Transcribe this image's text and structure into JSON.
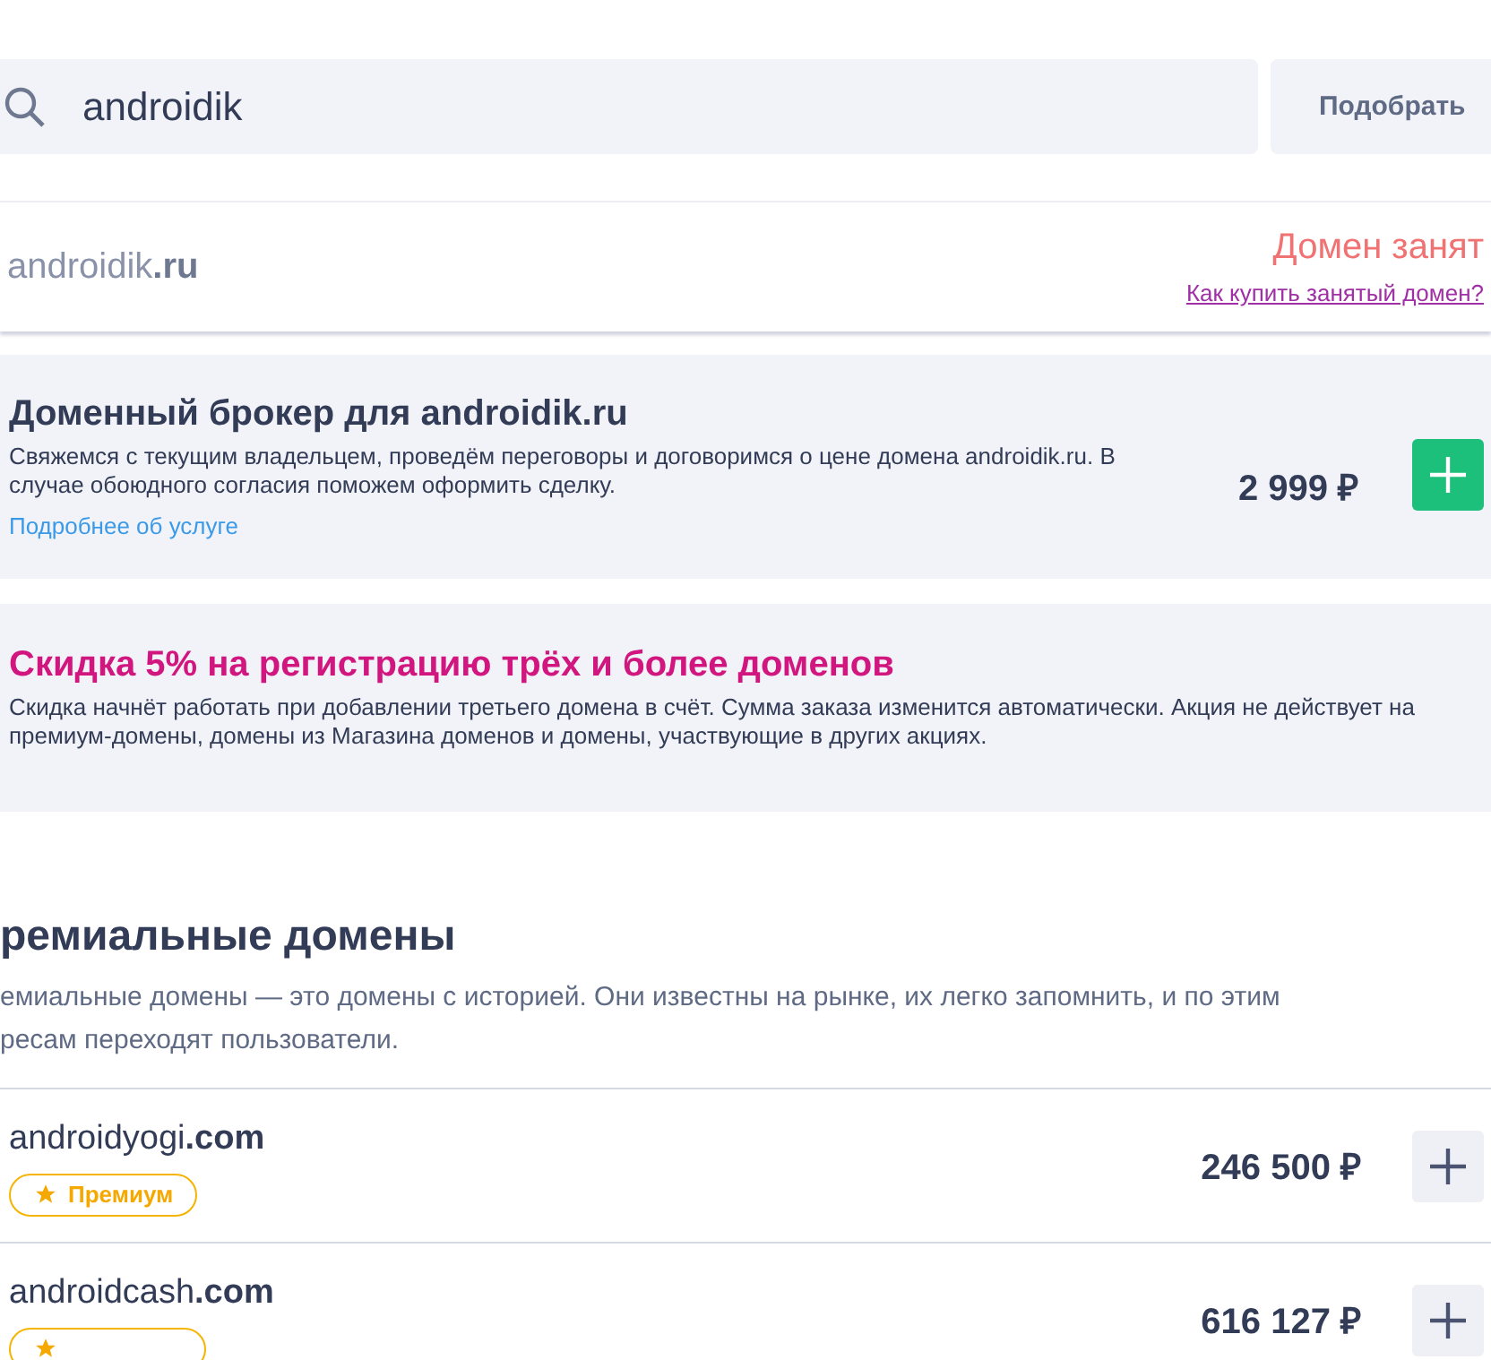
{
  "search": {
    "value": "androidik",
    "button": "Подобрать"
  },
  "domain": {
    "name": "androidik",
    "zone": ".ru",
    "status": "Домен занят",
    "link": "Как купить занятый домен?"
  },
  "broker": {
    "title": "Доменный брокер для androidik.ru",
    "text": "Свяжемся с текущим владельцем, проведём переговоры и договоримся о цене домена androidik.ru. В случае обоюдного согласия поможем оформить сделку.",
    "link": "Подробнее об услуге",
    "price": "2 999 ₽",
    "button_highlighted": true
  },
  "promo": {
    "title": "Скидка 5% на регистрацию трёх и более доменов",
    "text": "Скидка начнёт работать при добавлении третьего домена в счёт. Сумма заказа изменится автоматически. Акция не действует на премиум-домены, домены из Магазина доменов и домены, участвующие в других акциях."
  },
  "premium": {
    "title": "ремиальные домены",
    "description_lines": [
      "емиальные домены — это домены с историей. Они известны на рынке, их легко запомнить, и по этим",
      "ресам переходят пользователи."
    ],
    "rows": [
      {
        "name": "androidyogi",
        "zone": ".com",
        "badge": "Премиум",
        "price": "246 500 ₽",
        "button_highlighted": false
      },
      {
        "name": "androidcash",
        "zone": ".com",
        "price": "616 127 ₽",
        "button_highlighted": false
      }
    ]
  }
}
